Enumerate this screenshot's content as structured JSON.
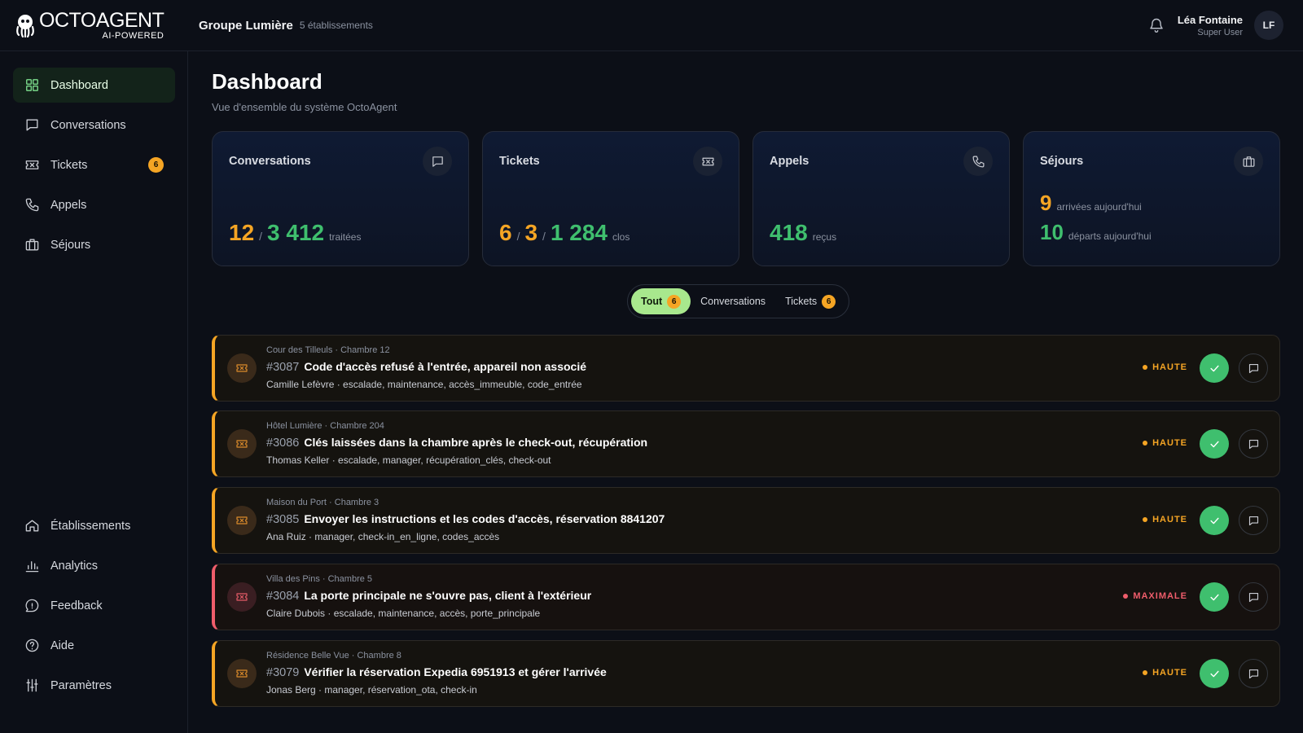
{
  "app": {
    "logo_name": "OCTOAGENT",
    "logo_sub": "AI-POWERED",
    "group_name": "Groupe Lumière",
    "group_count": "5 établissements"
  },
  "user": {
    "name": "Léa Fontaine",
    "role": "Super User",
    "initials": "LF"
  },
  "sidebar": {
    "top": [
      {
        "label": "Dashboard",
        "icon": "grid-icon",
        "active": true
      },
      {
        "label": "Conversations",
        "icon": "chat-icon"
      },
      {
        "label": "Tickets",
        "icon": "ticket-icon",
        "badge": "6"
      },
      {
        "label": "Appels",
        "icon": "phone-icon"
      },
      {
        "label": "Séjours",
        "icon": "luggage-icon"
      }
    ],
    "bottom": [
      {
        "label": "Établissements",
        "icon": "home-icon"
      },
      {
        "label": "Analytics",
        "icon": "bar-chart-icon"
      },
      {
        "label": "Feedback",
        "icon": "feedback-icon"
      },
      {
        "label": "Aide",
        "icon": "help-icon"
      },
      {
        "label": "Paramètres",
        "icon": "sliders-icon"
      }
    ]
  },
  "page": {
    "title": "Dashboard",
    "subtitle": "Vue d'ensemble du système OctoAgent"
  },
  "stats": {
    "conversations": {
      "title": "Conversations",
      "active": "12",
      "total": "3 412",
      "unit": "traitées"
    },
    "tickets": {
      "title": "Tickets",
      "open": "6",
      "pending": "3",
      "closed": "1 284",
      "unit": "clos"
    },
    "appels": {
      "title": "Appels",
      "value": "418",
      "unit": "reçus"
    },
    "sejours": {
      "title": "Séjours",
      "arrivals": "9",
      "arrivals_unit": "arrivées aujourd'hui",
      "departures": "10",
      "departures_unit": "départs aujourd'hui"
    }
  },
  "filters": {
    "all": {
      "label": "Tout",
      "badge": "6"
    },
    "conversations": {
      "label": "Conversations"
    },
    "tickets": {
      "label": "Tickets",
      "badge": "6"
    }
  },
  "tickets": [
    {
      "meta": "Cour des Tilleuls · Chambre 12",
      "id": "#3087",
      "title": "Code d'accès refusé à l'entrée, appareil non associé",
      "tags": "Camille Lefèvre · escalade, maintenance, accès_immeuble, code_entrée",
      "priority": "HAUTE",
      "level": "high"
    },
    {
      "meta": "Hôtel Lumière · Chambre 204",
      "id": "#3086",
      "title": "Clés laissées dans la chambre après le check-out, récupération",
      "tags": "Thomas Keller · escalade, manager, récupération_clés, check-out",
      "priority": "HAUTE",
      "level": "high"
    },
    {
      "meta": "Maison du Port · Chambre 3",
      "id": "#3085",
      "title": "Envoyer les instructions et les codes d'accès, réservation 8841207",
      "tags": "Ana Ruiz · manager, check-in_en_ligne, codes_accès",
      "priority": "HAUTE",
      "level": "high"
    },
    {
      "meta": "Villa des Pins · Chambre 5",
      "id": "#3084",
      "title": "La porte principale ne s'ouvre pas, client à l'extérieur",
      "tags": "Claire Dubois · escalade, maintenance, accès, porte_principale",
      "priority": "MAXIMALE",
      "level": "critical"
    },
    {
      "meta": "Résidence Belle Vue · Chambre 8",
      "id": "#3079",
      "title": "Vérifier la réservation Expedia 6951913 et gérer l'arrivée",
      "tags": "Jonas Berg · manager, réservation_ota, check-in",
      "priority": "HAUTE",
      "level": "high"
    }
  ],
  "colors": {
    "accent_green": "#3fbf6e",
    "accent_orange": "#f5a524",
    "critical_red": "#ef5d6b",
    "filter_active": "#a8e88d"
  }
}
